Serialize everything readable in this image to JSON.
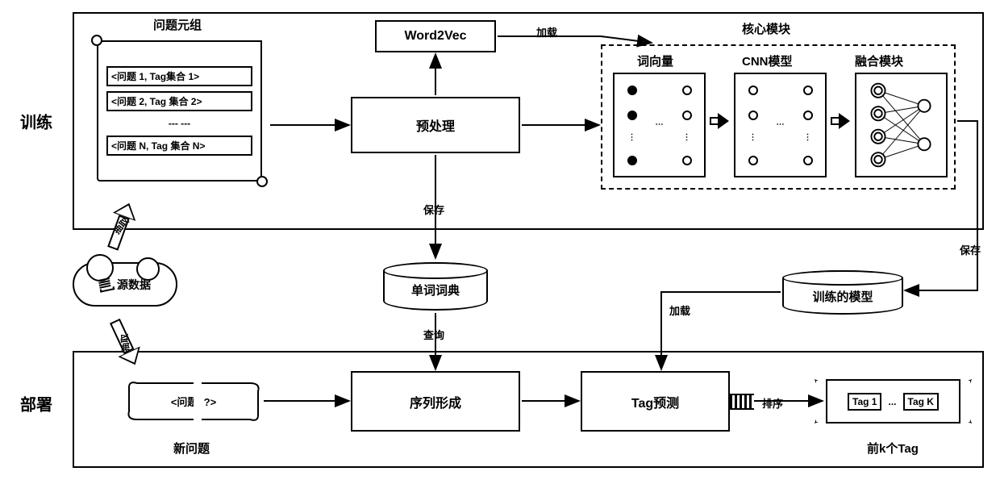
{
  "training": {
    "label": "训练",
    "question_tuple_title": "问题元组",
    "scroll_items": [
      "<问题 1, Tag集合 1>",
      "<问题 2, Tag 集合 2>",
      "--- ---",
      "<问题 N, Tag 集合 N>"
    ],
    "word2vec": "Word2Vec",
    "preprocess": "预处理",
    "core_module_title": "核心模块",
    "core_sub": {
      "wordvec": "词向量",
      "cnn": "CNN模型",
      "fusion": "融合模块"
    },
    "arrows": {
      "load": "加载",
      "save_preprocess": "保存",
      "save_model": "保存",
      "extract_up": "抽取",
      "extract_down": "抽取"
    }
  },
  "middle": {
    "source_data": "源数据",
    "word_dict": "单词词典",
    "trained_model": "训练的模型",
    "load": "加载",
    "query": "查询"
  },
  "deploy": {
    "label": "部署",
    "new_question_title": "新问题",
    "new_question_tuple": "<问题, ?>",
    "seq_form": "序列形成",
    "tag_predict": "Tag预测",
    "sort": "排序",
    "topk_title": "前k个Tag",
    "topk_cells": [
      "Tag 1",
      "...",
      "Tag K"
    ]
  }
}
